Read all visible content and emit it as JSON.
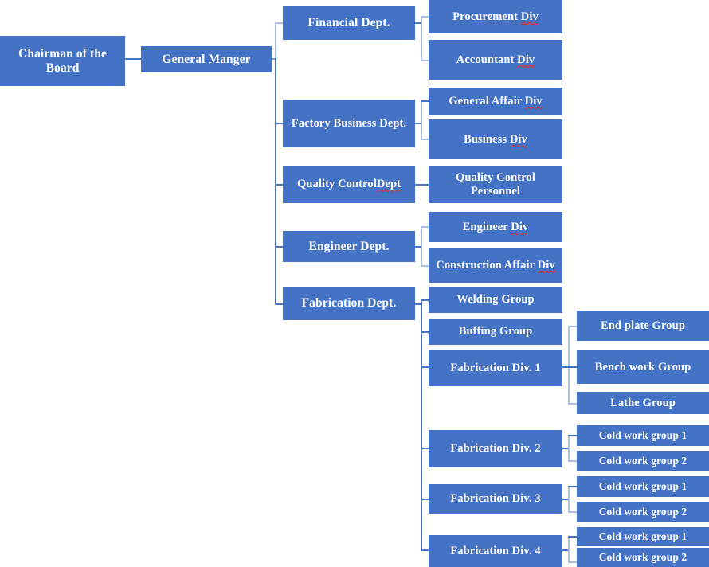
{
  "document": {
    "type": "organization-chart",
    "title": "Company Organization Chart",
    "box_color": "#4472C4",
    "text_color": "#FFFFFF",
    "connector_color": "#4472C4",
    "connector_color_light": "#A7BFE3",
    "background_color": "#FFFFFF"
  },
  "nodes": {
    "chairman": "Chairman of the Board",
    "general_manager": "General Manger",
    "financial_dept": "Financial Dept.",
    "procurement_div_a": "Procurement ",
    "procurement_div_b": "Div",
    "accountant_div_a": "Accountant ",
    "accountant_div_b": "Div",
    "factory_business_dept": "Factory Business Dept.",
    "general_affair_div_a": "General Affair ",
    "general_affair_div_b": "Div",
    "business_div_a": "Business ",
    "business_div_b": "Div",
    "quality_control_dept_a": "Quality Control",
    "quality_control_dept_b": "Dept",
    "quality_control_personnel": "Quality Control Personnel",
    "engineer_dept": "Engineer Dept.",
    "engineer_div_a": "Engineer ",
    "engineer_div_b": "Div",
    "construction_affair_div_a": "Construction Affair ",
    "construction_affair_div_b": "Div",
    "fabrication_dept": "Fabrication Dept.",
    "welding_group": "Welding Group",
    "buffing_group": "Buffing Group",
    "fabrication_div_1": "Fabrication Div. 1",
    "fabrication_div_2": "Fabrication Div. 2",
    "fabrication_div_3": "Fabrication Div. 3",
    "fabrication_div_4": "Fabrication Div. 4",
    "end_plate_group": "End plate Group",
    "bench_work_group": "Bench work Group",
    "lathe_group": "Lathe Group",
    "cold_work_group_1_a": "Cold work group 1",
    "cold_work_group_2_a": "Cold work group 2",
    "cold_work_group_1_b": "Cold work group 1",
    "cold_work_group_2_b": "Cold work group 2",
    "cold_work_group_1_c": "Cold work group 1",
    "cold_work_group_2_c": "Cold work group 2"
  }
}
